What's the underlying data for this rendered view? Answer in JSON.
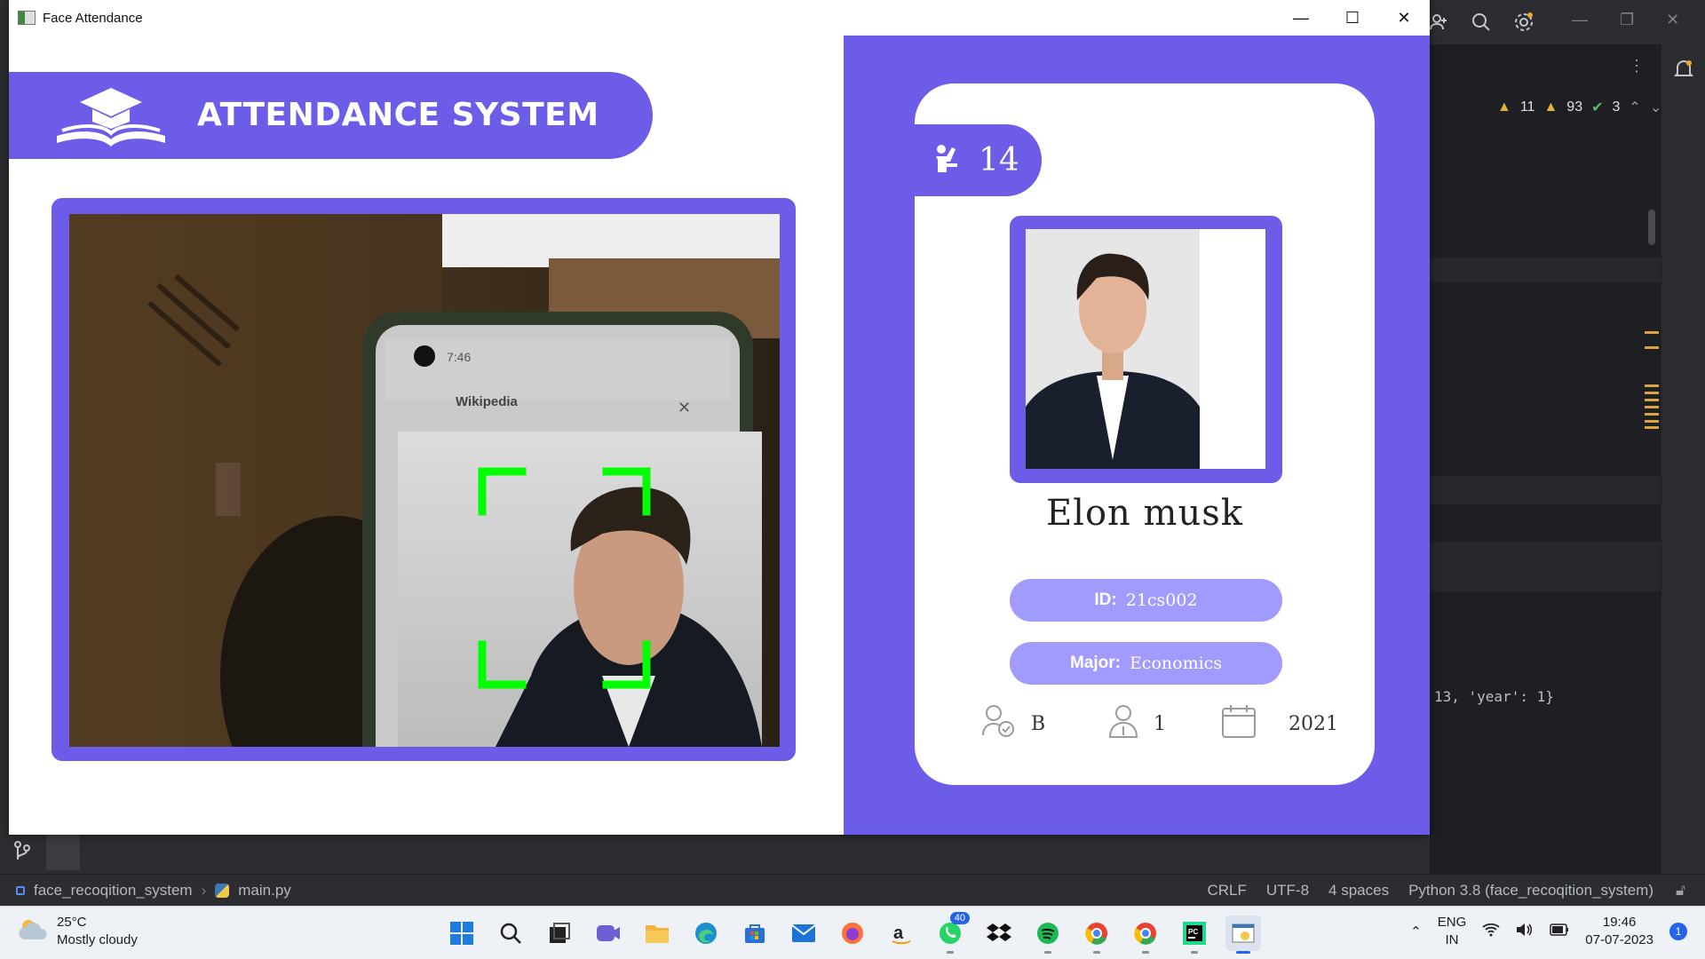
{
  "window": {
    "title": "Face Attendance",
    "controls": {
      "minimize": "—",
      "maximize": "☐",
      "close": "✕"
    }
  },
  "app": {
    "banner_title": "ATTENDANCE SYSTEM",
    "attendance_count": "14",
    "student": {
      "name": "Elon  musk",
      "id_label": "ID:",
      "id_value": "21cs002",
      "major_label": "Major:",
      "major_value": "Economics",
      "standing": "B",
      "year": "1",
      "starting_year": "2021"
    },
    "colors": {
      "accent": "#6c5ce7",
      "accent_light": "#a29bfe",
      "face_box": "#00ff00"
    },
    "camera_feed": {
      "phone_status_time": "7:46",
      "phone_page_title": "Wikipedia"
    }
  },
  "ide": {
    "inspections": {
      "warnings_a": "11",
      "warnings_b": "93",
      "ok": "3"
    },
    "console_text": "13, 'year': 1}",
    "status": {
      "project": "face_recoqition_system",
      "file": "main.py",
      "line_sep": "CRLF",
      "encoding": "UTF-8",
      "indent": "4 spaces",
      "interpreter": "Python 3.8 (face_recoqition_system)"
    }
  },
  "taskbar": {
    "weather_temp": "25°C",
    "weather_desc": "Mostly cloudy",
    "whatsapp_badge": "40",
    "lang_top": "ENG",
    "lang_bottom": "IN",
    "time": "19:46",
    "date": "07-07-2023",
    "notifications": "1"
  }
}
